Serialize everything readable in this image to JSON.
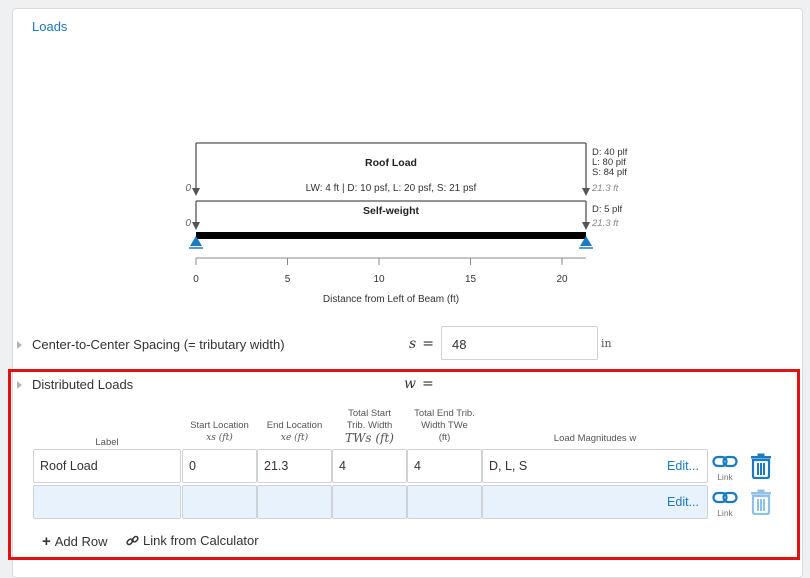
{
  "section": {
    "loads_link": "Loads"
  },
  "diagram": {
    "load_name": "Roof Load",
    "load_detail": "LW: 4 ft | D: 10 psf, L: 20 psf, S: 21 psf",
    "load_start": "0",
    "load_end_lines": [
      "D: 40 plf",
      "L: 80 plf",
      "S: 84 plf"
    ],
    "load_end_loc": "21.3 ft",
    "selfweight_name": "Self-weight",
    "selfweight_start": "0",
    "selfweight_end_line": "D: 5 plf",
    "selfweight_end_loc": "21.3 ft",
    "axis_ticks": [
      "0",
      "5",
      "10",
      "15",
      "20"
    ],
    "axis_label": "Distance from Left of Beam (ft)"
  },
  "spacing": {
    "label": "Center-to-Center Spacing (= tributary width)",
    "symbol": "s",
    "equals": "=",
    "value": "48",
    "unit": "in"
  },
  "distributed": {
    "label": "Distributed Loads",
    "symbol": "w",
    "equals": "=",
    "headers": {
      "label": "Label",
      "start_line1": "Start Location",
      "start_sym": "xs (ft)",
      "end_line1": "End Location",
      "end_sym": "xe (ft)",
      "tws_line1": "Total Start",
      "tws_line2": "Trib. Width",
      "tws_sym": "TWs (ft)",
      "twe_line1": "Total End Trib.",
      "twe_line2": "Width TWe",
      "twe_unit": "(ft)",
      "mag": "Load Magnitudes w"
    },
    "rows": [
      {
        "label": "Roof Load",
        "start": "0",
        "end": "21.3",
        "tws": "4",
        "twe": "4",
        "mag": "D, L, S",
        "edit": "Edit...",
        "link": "Link"
      },
      {
        "label": "",
        "start": "",
        "end": "",
        "tws": "",
        "twe": "",
        "mag": "",
        "edit": "Edit...",
        "link": "Link"
      }
    ],
    "add_row": "Add Row",
    "link_calc": "Link from Calculator"
  },
  "colors": {
    "accent": "#1a7ac2",
    "highlight": "#e11212",
    "support": "#1a7ac2"
  }
}
